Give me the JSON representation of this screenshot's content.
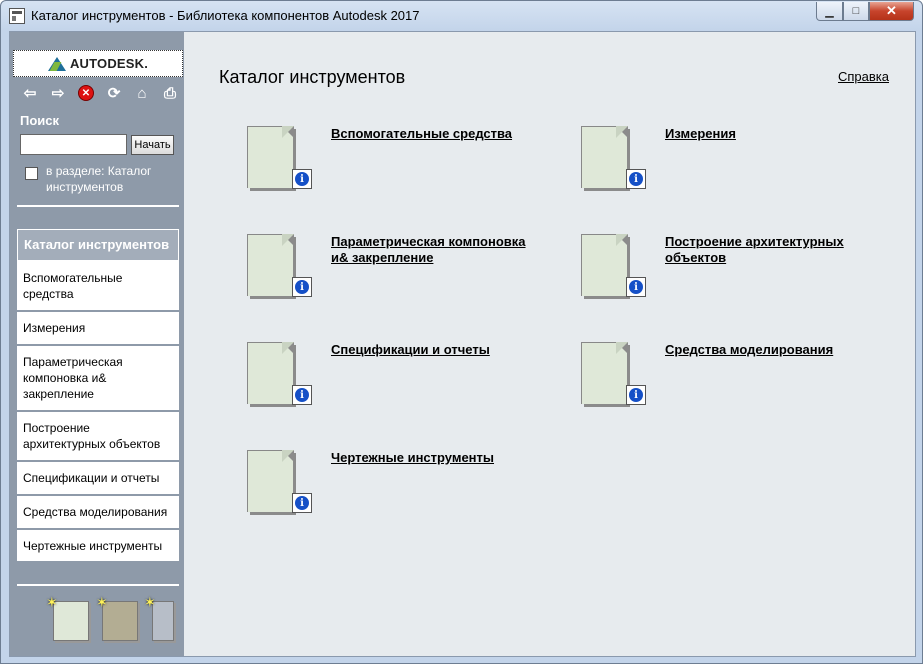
{
  "window": {
    "title": "Каталог инструментов - Библиотека компонентов Autodesk 2017",
    "min_glyph": "▁",
    "max_glyph": "□",
    "close_glyph": "✕"
  },
  "sidebar": {
    "logo_text": "AUTODESK.",
    "toolbar": {
      "back_glyph": "⇦",
      "forward_glyph": "⇨",
      "stop_glyph": "✕",
      "refresh_glyph": "⟳",
      "home_glyph": "⌂",
      "print_glyph": "⎙"
    },
    "search": {
      "label": "Поиск",
      "value": "",
      "button": "Начать",
      "scope_label": "в разделе: Каталог инструментов"
    },
    "nav_items": [
      {
        "label": "Каталог инструментов",
        "active": true
      },
      {
        "label": "Вспомогательные средства"
      },
      {
        "label": "Измерения"
      },
      {
        "label": "Параметрическая компоновка и& закрепление"
      },
      {
        "label": "Построение архитектурных объектов"
      },
      {
        "label": "Спецификации и отчеты"
      },
      {
        "label": "Средства моделирования"
      },
      {
        "label": "Чертежные инструменты"
      }
    ]
  },
  "main": {
    "title": "Каталог инструментов",
    "help_link": "Справка",
    "info_glyph": "i",
    "categories": [
      {
        "label": "Вспомогательные средства"
      },
      {
        "label": "Измерения"
      },
      {
        "label": "Параметрическая компоновка и& закрепление"
      },
      {
        "label": "Построение архитектурных объектов"
      },
      {
        "label": "Спецификации и отчеты"
      },
      {
        "label": "Средства моделирования"
      },
      {
        "label": "Чертежные инструменты"
      }
    ]
  },
  "colors": {
    "sidebar_bg": "#8e9aa9",
    "main_bg": "#e7ebee",
    "doc_fill": "#dfe8d8",
    "info_blue": "#1550c7"
  }
}
